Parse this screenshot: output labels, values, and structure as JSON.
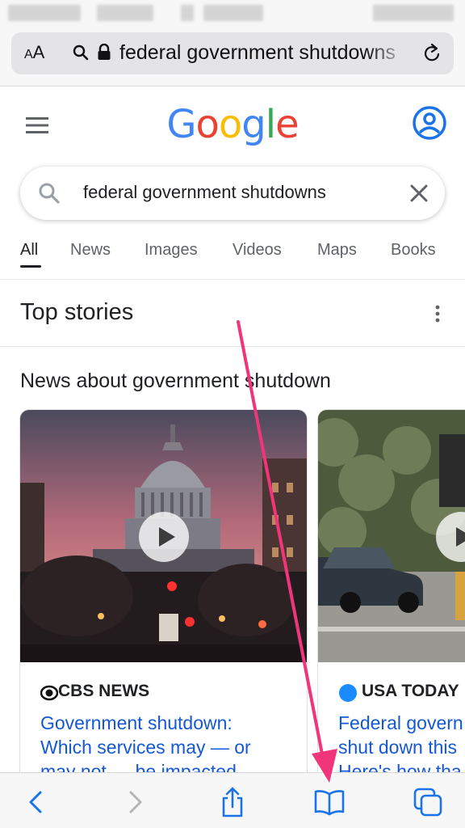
{
  "browser": {
    "text_size_label": "AA",
    "address_text": "federal government shutdowns",
    "icons": [
      "search-icon",
      "lock-icon",
      "reload-icon"
    ]
  },
  "google": {
    "logo_letters": [
      "G",
      "o",
      "o",
      "g",
      "l",
      "e"
    ],
    "logo_colors": [
      "#4285F4",
      "#EA4335",
      "#FBBC05",
      "#4285F4",
      "#34A853",
      "#EA4335"
    ],
    "search_query": "federal government shutdowns",
    "tabs": [
      "All",
      "News",
      "Images",
      "Videos",
      "Maps",
      "Books"
    ],
    "active_tab": "All"
  },
  "top_stories": {
    "title": "Top stories",
    "subheading": "News about government shutdown",
    "cards": [
      {
        "publisher": "CBS NEWS",
        "headline_lines": [
          "Government shutdown:",
          "Which services may — or",
          "may not — be impacted"
        ]
      },
      {
        "publisher": "USA TODAY",
        "headline_lines": [
          "Federal govern",
          "shut down this",
          "Here's how tha"
        ]
      }
    ]
  },
  "toolbar": {
    "buttons": [
      "back-icon",
      "forward-icon",
      "share-icon",
      "bookmarks-icon",
      "tabs-icon"
    ]
  },
  "colors": {
    "link_blue": "#1558d6",
    "annotation_arrow": "#f0357a",
    "safari_blue": "#1a73e8"
  }
}
